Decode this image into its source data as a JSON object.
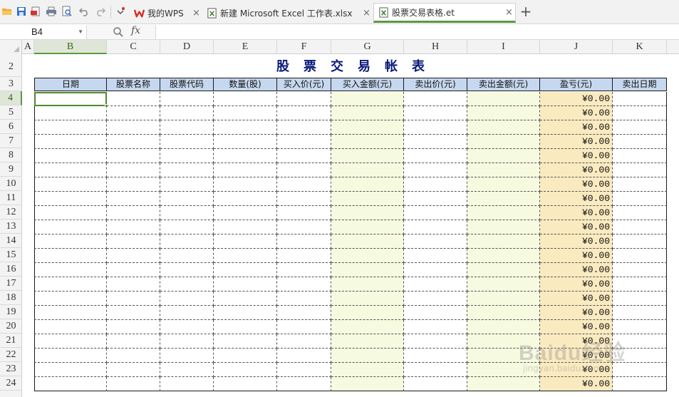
{
  "toolbar": {
    "icons": [
      "open-folder-icon",
      "save-icon",
      "export-pdf-icon",
      "print-icon",
      "print-preview-icon",
      "undo-icon",
      "redo-icon",
      "customize-dropdown-icon"
    ]
  },
  "tabs": [
    {
      "label": "我的WPS",
      "icon": "wps-logo-icon",
      "close": "×"
    },
    {
      "label": "新建 Microsoft Excel 工作表.xlsx",
      "icon": "spreadsheet-icon",
      "close": "×"
    },
    {
      "label": "股票交易表格.et",
      "icon": "spreadsheet-icon",
      "close": "×",
      "active": true
    }
  ],
  "new_tab": "+",
  "formula_bar": {
    "cell_ref": "B4",
    "fx": "fx",
    "value": ""
  },
  "columns": [
    "A",
    "B",
    "C",
    "D",
    "E",
    "F",
    "G",
    "H",
    "I",
    "J",
    "K"
  ],
  "selected_column": "B",
  "rows": [
    "2",
    "3",
    "4",
    "5",
    "6",
    "7",
    "8",
    "9",
    "10",
    "11",
    "12",
    "13",
    "14",
    "15",
    "16",
    "17",
    "18",
    "19",
    "20",
    "21",
    "22",
    "23",
    "24"
  ],
  "selected_row": "4",
  "sheet": {
    "title": "股票交易帐表",
    "headers": [
      "日期",
      "股票名称",
      "股票代码",
      "数量(股)",
      "买入价(元)",
      "买入金额(元)",
      "卖出价(元)",
      "卖出金额(元)",
      "盈亏(元)",
      "卖出日期"
    ],
    "profit_value": "¥0.00",
    "row_count": 21
  },
  "colors": {
    "header_fill": "#c6d8ef",
    "buy_amount_fill": "#f6fadf",
    "sell_amount_fill": "#f6fadf",
    "profit_fill": "#faeac0",
    "title_color": "#0b1a7a",
    "selection": "#4d8a2f"
  },
  "watermark": {
    "text": "Baidu经验",
    "sub": "jingyan.baidu.com"
  }
}
